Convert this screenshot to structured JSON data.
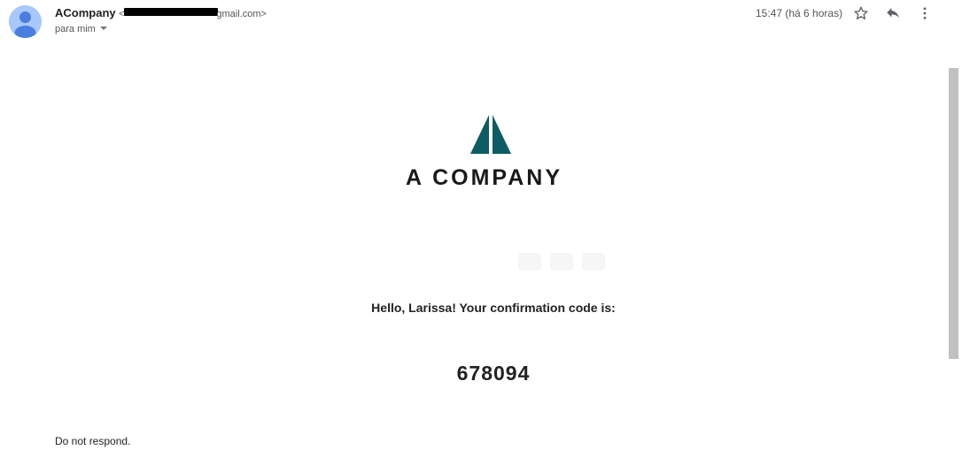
{
  "sender": {
    "name": "ACompany",
    "email_open": "<",
    "email_domain": "gmail.com>"
  },
  "recipient": {
    "label": "para mim"
  },
  "header": {
    "timestamp": "15:47 (há 6 horas)"
  },
  "icons": {
    "avatar": "person-avatar-icon",
    "star": "star-outline-icon",
    "reply": "reply-arrow-icon",
    "more": "vertical-dots-icon",
    "dropdown": "caret-down-icon",
    "logo": "triangle-logo-icon"
  },
  "colors": {
    "logo_teal": "#0d5c63",
    "avatar_bg": "#a8c7fa",
    "avatar_fg": "#4a7fe0"
  },
  "body": {
    "brand": "A COMPANY",
    "greeting": "Hello, Larissa! Your confirmation code is:",
    "code": "678094",
    "footer": "Do not respond."
  }
}
